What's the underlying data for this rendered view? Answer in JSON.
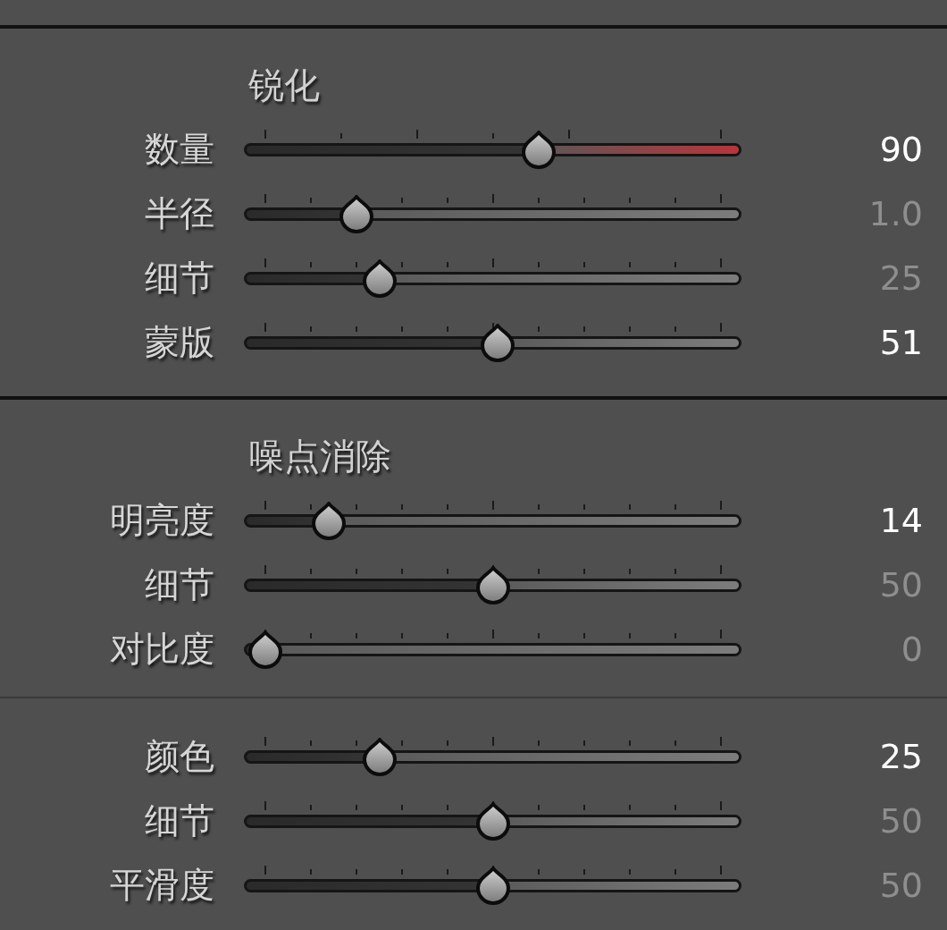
{
  "sections": [
    {
      "title": "锐化",
      "groups": [
        {
          "sliders": [
            {
              "label": "数量",
              "kind": "gradient",
              "level": 0.6,
              "value": "90",
              "highlighted": true
            },
            {
              "label": "半径",
              "kind": "plain",
              "level": 0.2,
              "value": "1.0",
              "highlighted": false
            },
            {
              "label": "细节",
              "kind": "plain",
              "level": 0.25,
              "value": "25",
              "highlighted": false
            },
            {
              "label": "蒙版",
              "kind": "plain",
              "level": 0.51,
              "value": "51",
              "highlighted": true
            }
          ]
        }
      ]
    },
    {
      "title": "噪点消除",
      "groups": [
        {
          "sliders": [
            {
              "label": "明亮度",
              "kind": "plain",
              "level": 0.14,
              "value": "14",
              "highlighted": true
            },
            {
              "label": "细节",
              "kind": "plain",
              "level": 0.5,
              "value": "50",
              "highlighted": false
            },
            {
              "label": "对比度",
              "kind": "plain",
              "level": 0,
              "value": "0",
              "highlighted": false
            }
          ]
        },
        {
          "sliders": [
            {
              "label": "颜色",
              "kind": "plain",
              "level": 0.25,
              "value": "25",
              "highlighted": true
            },
            {
              "label": "细节",
              "kind": "plain",
              "level": 0.5,
              "value": "50",
              "highlighted": false
            },
            {
              "label": "平滑度",
              "kind": "plain",
              "level": 0.5,
              "value": "50",
              "highlighted": false
            }
          ]
        }
      ]
    }
  ]
}
